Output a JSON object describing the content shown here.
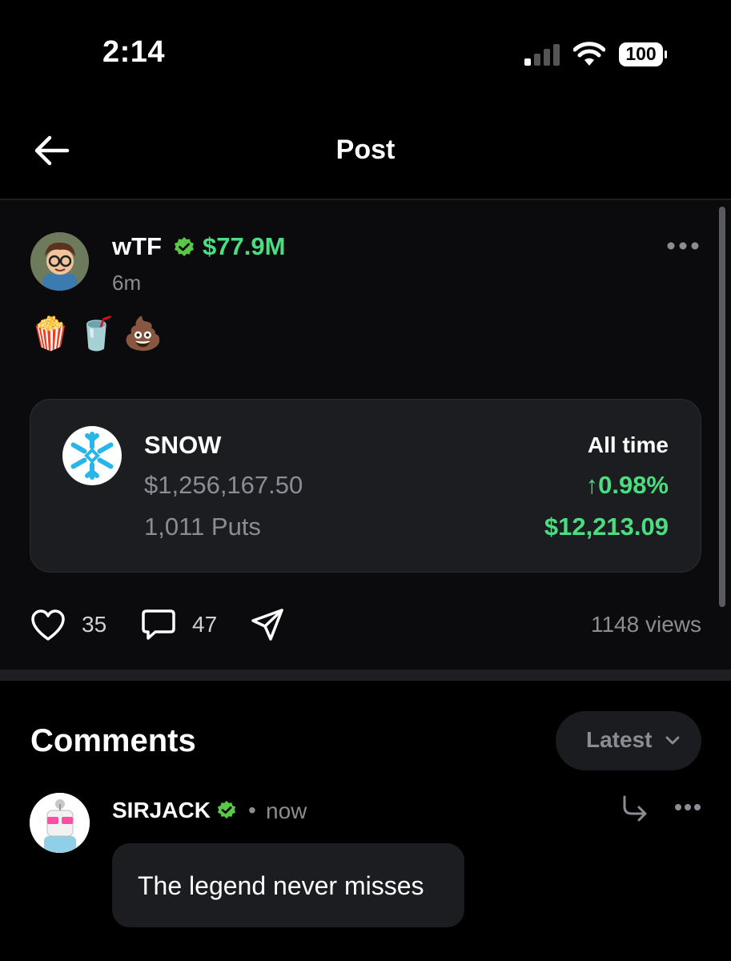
{
  "status_bar": {
    "time": "2:14",
    "battery": "100"
  },
  "header": {
    "title": "Post"
  },
  "post": {
    "username": "wTF",
    "net_worth": "$77.9M",
    "time_ago": "6m",
    "emojis": "🍿🥤💩",
    "trade": {
      "ticker": "SNOW",
      "position_value": "$1,256,167.50",
      "contracts": "1,011 Puts",
      "range_label": "All time",
      "percent_change": "↑0.98%",
      "pnl": "$12,213.09"
    },
    "likes": "35",
    "comments": "47",
    "views": "1148 views"
  },
  "comments_section": {
    "title": "Comments",
    "sort_label": "Latest",
    "items": [
      {
        "username": "SIRJACK",
        "separator": "•",
        "time": "now",
        "text": "The legend never misses"
      }
    ]
  },
  "colors": {
    "accent_green": "#4ade80",
    "verified_green": "#5ac847",
    "background": "#000000",
    "card": "#1c1d20"
  }
}
